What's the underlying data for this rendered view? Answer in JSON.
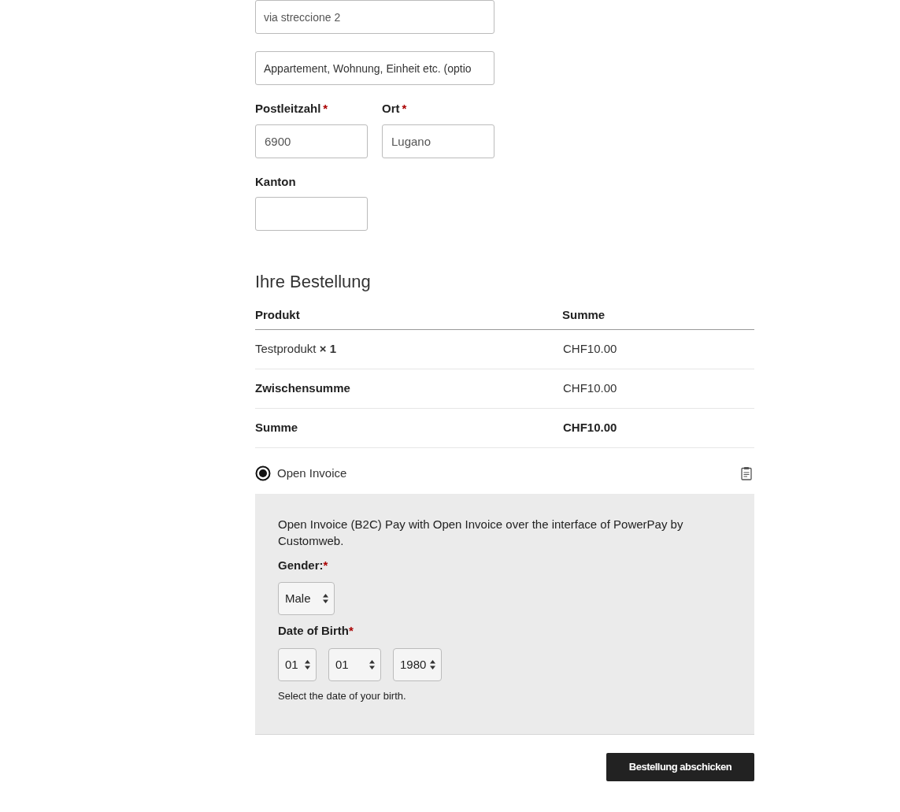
{
  "address_fields": [
    {
      "value": "via streccione 2"
    },
    {
      "placeholder": "Appartement, Wohnung, Einheit etc. (optio"
    }
  ],
  "location_fields": [
    {
      "label": "Postleitzahl",
      "required_mark": "*",
      "value": "6900"
    },
    {
      "label": "Ort",
      "required_mark": "*",
      "value": "Lugano"
    }
  ],
  "region_field": {
    "label": "Kanton"
  },
  "order": {
    "title": "Ihre Bestellung",
    "columns": [
      "Produkt",
      "Summe"
    ],
    "rows": [
      {
        "product": "Testprodukt **× 1**",
        "total": "CHF10.00"
      }
    ],
    "totals": [
      {
        "label": "Zwischensumme",
        "value": "CHF10.00",
        "emphasis": false
      },
      {
        "label": "Summe",
        "value": "CHF10.00",
        "emphasis": true
      }
    ]
  },
  "payment": {
    "methods": [
      {
        "label": "Open Invoice",
        "selected": true
      }
    ],
    "description": "Open Invoice (B2C) Pay with Open Invoice over the interface of PowerPay by Customweb.",
    "gender": {
      "label": "Gender:",
      "required_mark": "*",
      "value": "Male"
    },
    "birth_date": {
      "label": "Date of Birth",
      "required_mark": "*",
      "values": [
        "01",
        "01",
        "1980"
      ],
      "help": "Select the date of your birth."
    }
  },
  "submit_button": "Bestellung abschicken"
}
